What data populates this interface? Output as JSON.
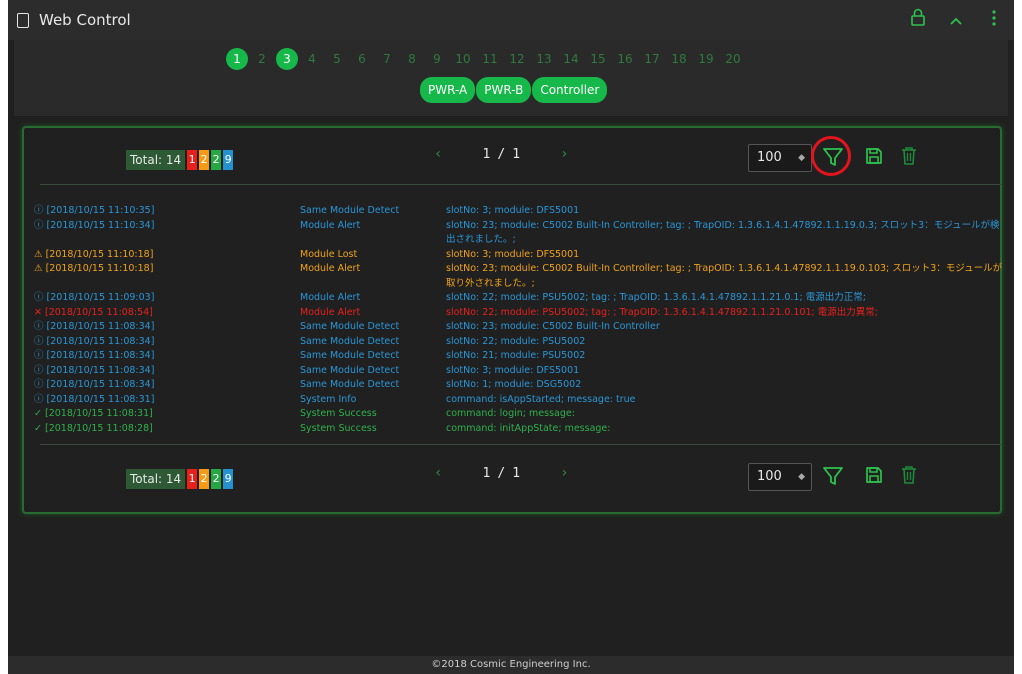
{
  "app": {
    "title": "Web Control"
  },
  "slots": [
    {
      "label": "1",
      "active": true
    },
    {
      "label": "2",
      "active": false
    },
    {
      "label": "3",
      "active": true
    },
    {
      "label": "4",
      "active": false
    },
    {
      "label": "5",
      "active": false
    },
    {
      "label": "6",
      "active": false
    },
    {
      "label": "7",
      "active": false
    },
    {
      "label": "8",
      "active": false
    },
    {
      "label": "9",
      "active": false
    },
    {
      "label": "10",
      "active": false
    },
    {
      "label": "11",
      "active": false
    },
    {
      "label": "12",
      "active": false
    },
    {
      "label": "13",
      "active": false
    },
    {
      "label": "14",
      "active": false
    },
    {
      "label": "15",
      "active": false
    },
    {
      "label": "16",
      "active": false
    },
    {
      "label": "17",
      "active": false
    },
    {
      "label": "18",
      "active": false
    },
    {
      "label": "19",
      "active": false
    },
    {
      "label": "20",
      "active": false
    }
  ],
  "modules": [
    "PWR-A",
    "PWR-B",
    "Controller"
  ],
  "pager": {
    "total_label": "Total: 14",
    "badges": [
      {
        "value": "1",
        "color": "red"
      },
      {
        "value": "2",
        "color": "orange"
      },
      {
        "value": "2",
        "color": "green"
      },
      {
        "value": "9",
        "color": "blue"
      }
    ],
    "page": "1",
    "separator": "/",
    "pages": "1",
    "page_size": "100"
  },
  "logs": [
    {
      "level": "info",
      "icon": "ⓘ",
      "ts": "[2018/10/15 11:10:35]",
      "type": "Same Module Detect",
      "msg": "slotNo: 3; module: DFS5001"
    },
    {
      "level": "info",
      "icon": "ⓘ",
      "ts": "[2018/10/15 11:10:34]",
      "type": "Module Alert",
      "msg": "slotNo: 23; module: C5002 Built-In Controller; tag: ; TrapOID: 1.3.6.1.4.1.47892.1.1.19.0.3; スロット3：モジュールが検出されました。;"
    },
    {
      "level": "warn",
      "icon": "⚠",
      "ts": "[2018/10/15 11:10:18]",
      "type": "Module Lost",
      "msg": "slotNo: 3; module: DFS5001"
    },
    {
      "level": "warn",
      "icon": "⚠",
      "ts": "[2018/10/15 11:10:18]",
      "type": "Module Alert",
      "msg": "slotNo: 23; module: C5002 Built-In Controller; tag: ; TrapOID: 1.3.6.1.4.1.47892.1.1.19.0.103; スロット3：モジュールが取り外されました。;"
    },
    {
      "level": "info",
      "icon": "ⓘ",
      "ts": "[2018/10/15 11:09:03]",
      "type": "Module Alert",
      "msg": "slotNo: 22; module: PSU5002; tag: ; TrapOID: 1.3.6.1.4.1.47892.1.1.21.0.1; 電源出力正常;"
    },
    {
      "level": "err",
      "icon": "✕",
      "ts": "[2018/10/15 11:08:54]",
      "type": "Module Alert",
      "msg": "slotNo: 22; module: PSU5002; tag: ; TrapOID: 1.3.6.1.4.1.47892.1.1.21.0.101; 電源出力異常;"
    },
    {
      "level": "info",
      "icon": "ⓘ",
      "ts": "[2018/10/15 11:08:34]",
      "type": "Same Module Detect",
      "msg": "slotNo: 23; module: C5002 Built-In Controller"
    },
    {
      "level": "info",
      "icon": "ⓘ",
      "ts": "[2018/10/15 11:08:34]",
      "type": "Same Module Detect",
      "msg": "slotNo: 22; module: PSU5002"
    },
    {
      "level": "info",
      "icon": "ⓘ",
      "ts": "[2018/10/15 11:08:34]",
      "type": "Same Module Detect",
      "msg": "slotNo: 21; module: PSU5002"
    },
    {
      "level": "info",
      "icon": "ⓘ",
      "ts": "[2018/10/15 11:08:34]",
      "type": "Same Module Detect",
      "msg": "slotNo: 3; module: DFS5001"
    },
    {
      "level": "info",
      "icon": "ⓘ",
      "ts": "[2018/10/15 11:08:34]",
      "type": "Same Module Detect",
      "msg": "slotNo: 1; module: DSG5002"
    },
    {
      "level": "info",
      "icon": "ⓘ",
      "ts": "[2018/10/15 11:08:31]",
      "type": "System Info",
      "msg": "command: isAppStarted; message: true"
    },
    {
      "level": "ok",
      "icon": "✓",
      "ts": "[2018/10/15 11:08:31]",
      "type": "System Success",
      "msg": "command: login; message:"
    },
    {
      "level": "ok",
      "icon": "✓",
      "ts": "[2018/10/15 11:08:28]",
      "type": "System Success",
      "msg": "command: initAppState; message:"
    }
  ],
  "footer": {
    "text": "©2018 Cosmic Engineering Inc."
  },
  "colors": {
    "accent": "#17b84a",
    "info": "#2a96d6",
    "warn": "#f0a21a",
    "error": "#e8201c",
    "success": "#2fb14c",
    "highlight_ring": "#e2141e"
  }
}
